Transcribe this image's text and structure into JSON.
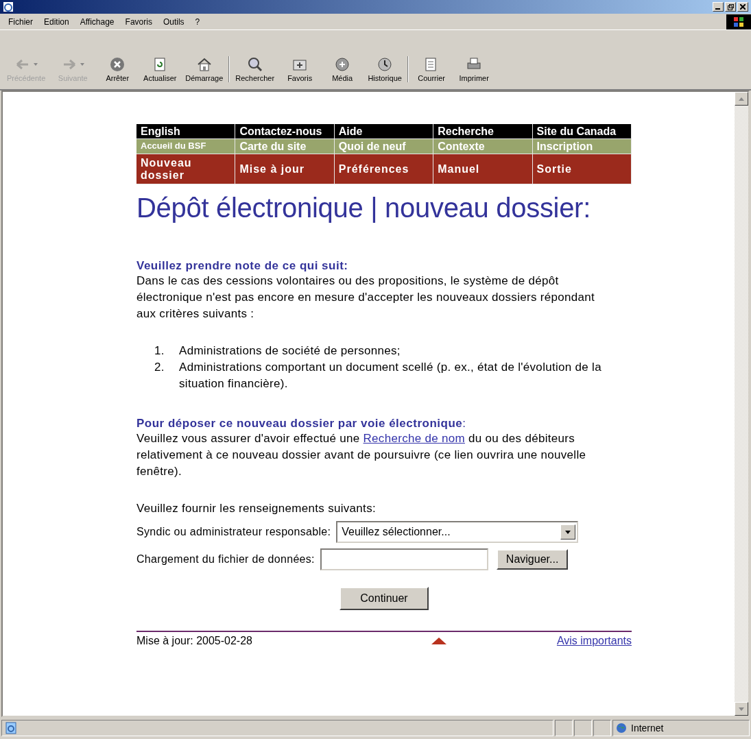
{
  "menu": [
    {
      "label": "Fichier"
    },
    {
      "label": "Edition"
    },
    {
      "label": "Affichage"
    },
    {
      "label": "Favoris"
    },
    {
      "label": "Outils"
    },
    {
      "label": "?"
    }
  ],
  "toolbar": [
    {
      "kind": "back",
      "label": "Précédente",
      "disabled": true,
      "dropdown": true
    },
    {
      "kind": "forward",
      "label": "Suivante",
      "disabled": true,
      "dropdown": true
    },
    {
      "kind": "stop",
      "label": "Arrêter",
      "disabled": false,
      "dropdown": false
    },
    {
      "kind": "refresh",
      "label": "Actualiser",
      "disabled": false,
      "dropdown": false
    },
    {
      "kind": "home",
      "label": "Démarrage",
      "disabled": false,
      "dropdown": false
    },
    {
      "kind": "search",
      "label": "Rechercher",
      "disabled": false,
      "dropdown": false
    },
    {
      "kind": "favorites",
      "label": "Favoris",
      "disabled": false,
      "dropdown": false
    },
    {
      "kind": "media",
      "label": "Média",
      "disabled": false,
      "dropdown": false
    },
    {
      "kind": "history",
      "label": "Historique",
      "disabled": false,
      "dropdown": false
    },
    {
      "kind": "mail",
      "label": "Courrier",
      "disabled": false,
      "dropdown": false
    },
    {
      "kind": "print",
      "label": "Imprimer",
      "disabled": false,
      "dropdown": false
    }
  ],
  "nav_rows": [
    {
      "color": "#000000",
      "items": [
        "English",
        "Contactez-nous",
        "Aide",
        "Recherche",
        "Site du Canada"
      ]
    },
    {
      "color": "#98a56c",
      "items": [
        "Accueil du BSF",
        "Carte du site",
        "Quoi de neuf",
        "Contexte",
        "Inscription"
      ]
    },
    {
      "color": "#9b2a1c",
      "items": [
        "Nouveau dossier",
        "Mise à jour",
        "Préférences",
        "Manuel",
        "Sortie"
      ]
    }
  ],
  "heading": "Dépôt électronique | nouveau dossier:",
  "note": {
    "title": "Veuillez prendre note de ce qui suit:",
    "text": "Dans le cas des cessions volontaires ou des propositions, le système de dépôt électronique n'est pas encore en mesure d'accepter les nouveaux dossiers répondant aux critères suivants :",
    "items": [
      {
        "number": "1.",
        "text": "Administrations de société de personnes;"
      },
      {
        "number": "2.",
        "text": "Administrations comportant un document scellé (p. ex., état de l'évolution de la situation financière)."
      }
    ]
  },
  "filing": {
    "title": "Pour déposer ce nouveau dossier par voie électronique",
    "title_end": ":",
    "text_before": "Veuillez vous assurer d'avoir effectué une ",
    "link": "Recherche de nom",
    "text_after": " du ou des débiteurs relativement à ce nouveau dossier avant de poursuivre (ce lien ouvrira une nouvelle fenêtre)."
  },
  "form": {
    "intro": "Veuillez fournir les renseignements suivants:",
    "trustee_label": "Syndic ou administrateur responsable:",
    "trustee_value": "Veuillez sélectionner...",
    "file_label": "Chargement du fichier de données:",
    "browse_button": "Naviguer...",
    "submit_button": "Continuer"
  },
  "footer": {
    "updated": "Mise à jour: 2005-02-28",
    "link": "Avis importants"
  },
  "status_bar": {
    "zone": "Internet"
  }
}
